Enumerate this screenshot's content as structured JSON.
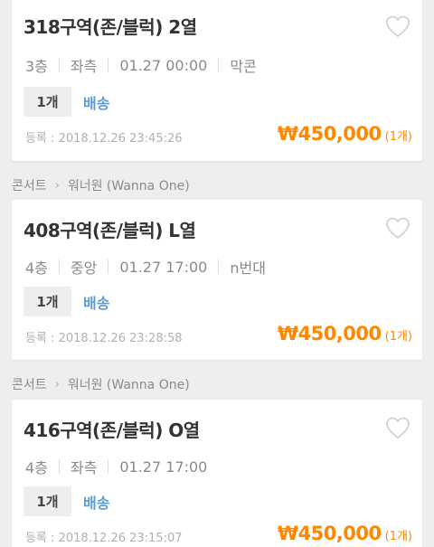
{
  "listings": [
    {
      "title": "318구역(존/블럭) 2열",
      "floor": "3층",
      "side": "좌측",
      "datetime": "01.27 00:00",
      "extra": "막콘",
      "qty_tag": "1개",
      "delivery": "배송",
      "registered": "등록 : 2018.12.26 23:45:26",
      "price": "₩450,000",
      "price_qty": "(1개)"
    },
    {
      "title": "408구역(존/블럭) L열",
      "floor": "4층",
      "side": "중앙",
      "datetime": "01.27 17:00",
      "extra": "n번대",
      "qty_tag": "1개",
      "delivery": "배송",
      "registered": "등록 : 2018.12.26 23:28:58",
      "price": "₩450,000",
      "price_qty": "(1개)"
    },
    {
      "title": "416구역(존/블럭) O열",
      "floor": "4층",
      "side": "좌측",
      "datetime": "01.27 17:00",
      "qty_tag": "1개",
      "delivery": "배송",
      "registered": "등록 : 2018.12.26 23:15:07",
      "price": "₩450,000",
      "price_qty": "(1개)"
    }
  ],
  "breadcrumbs": [
    {
      "category": "콘서트",
      "event": "워너원 (Wanna One)"
    },
    {
      "category": "콘서트",
      "event": "워너원 (Wanna One)"
    }
  ],
  "icons": {
    "favorite": "heart-outline-icon",
    "chevron": "chevron-right-icon"
  },
  "colors": {
    "price": "#ff8800",
    "delivery": "#5b9bd5",
    "title": "#333333",
    "background": "#eeeeee"
  }
}
